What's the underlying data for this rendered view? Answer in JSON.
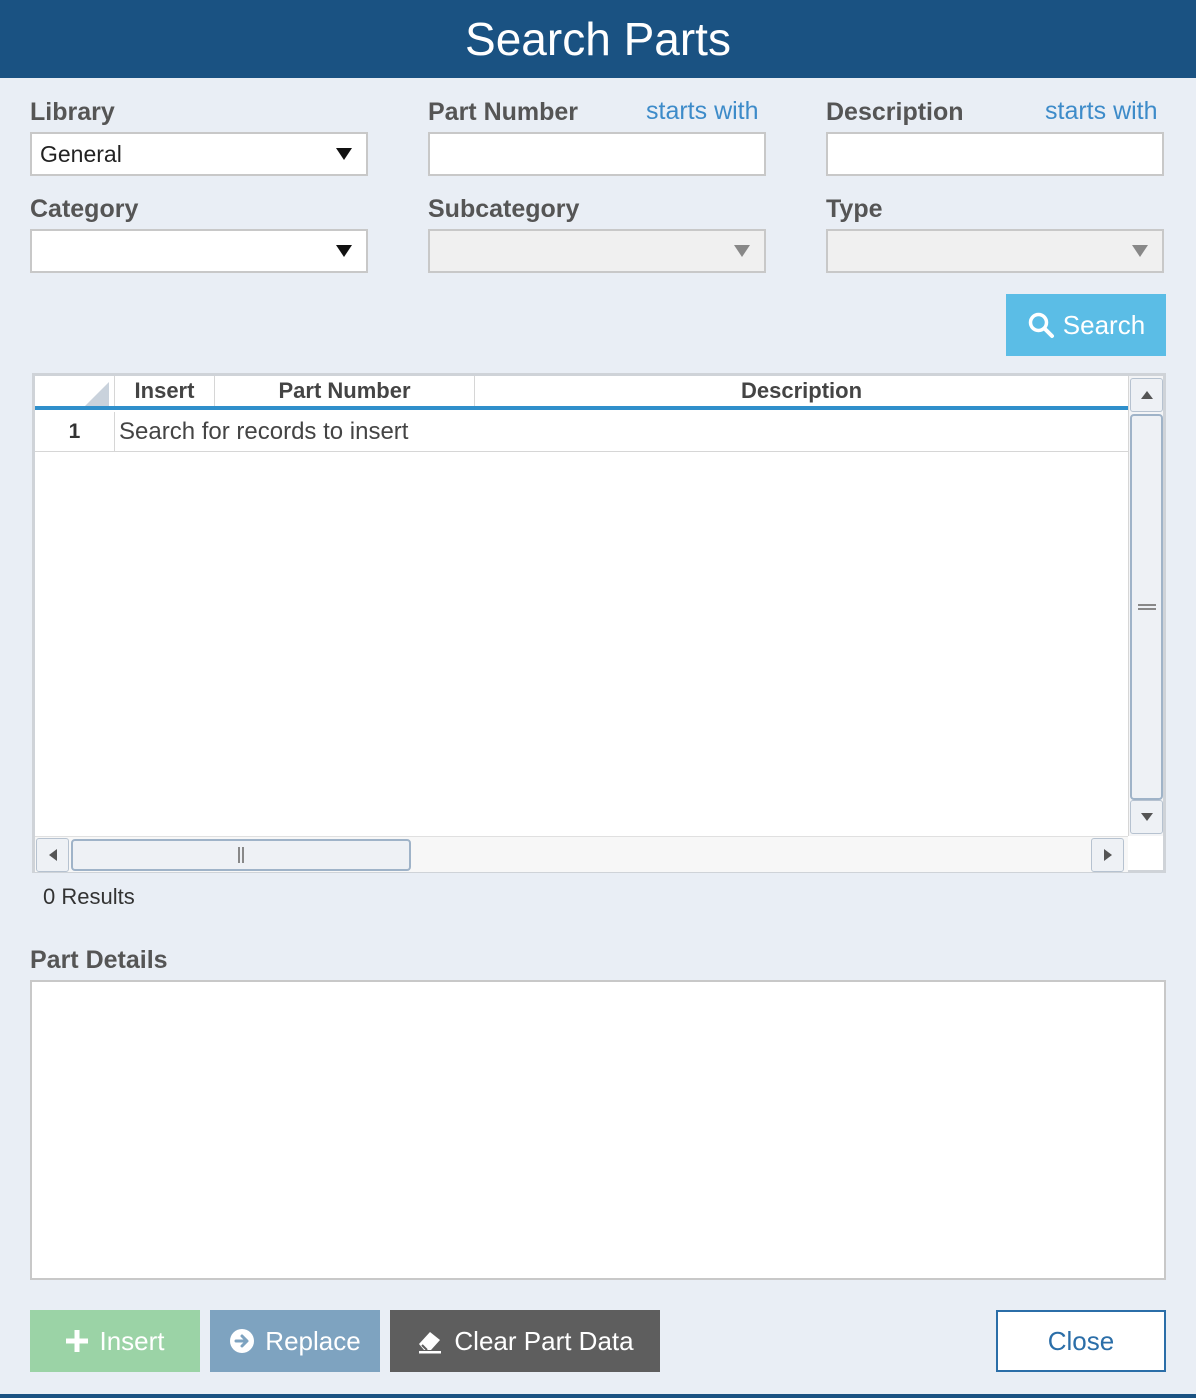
{
  "window": {
    "title": "Search Parts"
  },
  "filters": {
    "library": {
      "label": "Library",
      "value": "General"
    },
    "part_number": {
      "label": "Part Number",
      "modifier": "starts with",
      "value": ""
    },
    "description": {
      "label": "Description",
      "modifier": "starts with",
      "value": ""
    },
    "category": {
      "label": "Category",
      "value": ""
    },
    "subcategory": {
      "label": "Subcategory",
      "value": ""
    },
    "type": {
      "label": "Type",
      "value": ""
    }
  },
  "search_button": {
    "label": "Search",
    "icon": "search-icon"
  },
  "grid": {
    "columns": [
      "Insert",
      "Part Number",
      "Description"
    ],
    "rows": [
      {
        "num": "1",
        "text": "Search for records to insert"
      }
    ]
  },
  "results": {
    "text": "0 Results"
  },
  "part_details": {
    "label": "Part Details"
  },
  "actions": {
    "insert": {
      "label": "Insert",
      "icon": "plus-icon",
      "color": "#9bd3a6"
    },
    "replace": {
      "label": "Replace",
      "icon": "arrow-right-circle-icon",
      "color": "#7ea3c0"
    },
    "clear": {
      "label": "Clear Part Data",
      "icon": "eraser-icon",
      "color": "#5e5e5e"
    },
    "close": {
      "label": "Close"
    }
  },
  "colors": {
    "titlebar": "#1a5282",
    "accent": "#3d8bc9",
    "search": "#5bbde6"
  }
}
